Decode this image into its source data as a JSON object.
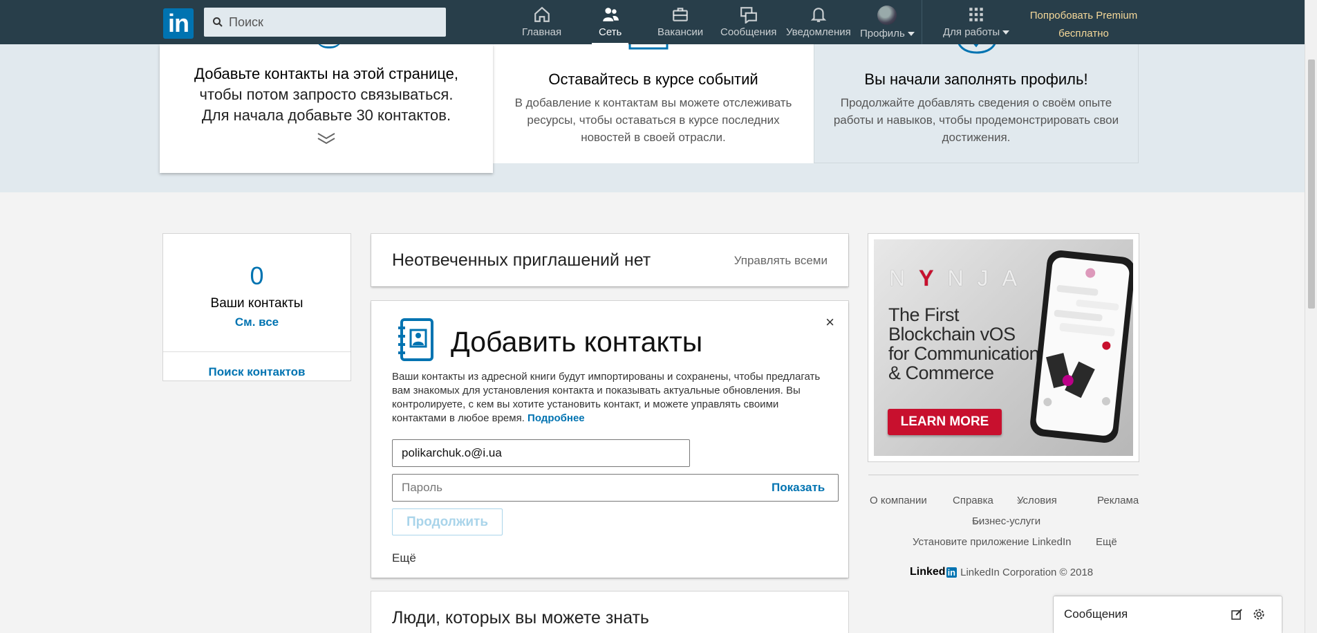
{
  "nav": {
    "search_placeholder": "Поиск",
    "items": [
      {
        "label": "Главная"
      },
      {
        "label": "Сеть"
      },
      {
        "label": "Вакансии"
      },
      {
        "label": "Сообщения"
      },
      {
        "label": "Уведомления"
      },
      {
        "label": "Профиль"
      },
      {
        "label": "Для работы"
      }
    ],
    "premium_line1": "Попробовать Premium",
    "premium_line2": "бесплатно",
    "logo": "in",
    "accent": "#0073b1",
    "bar_color": "#283e4a"
  },
  "banner": {
    "card1_title": "Добавьте контакты на этой странице,",
    "card1_line2": "чтобы потом запросто связываться.",
    "card1_line3": "Для начала добавьте 30 контактов.",
    "card2_title": "Оставайтесь в курсе событий",
    "card2_text": "В добавление к контактам вы можете отслеживать ресурсы, чтобы оставаться в курсе последних новостей в своей отрасли.",
    "card3_title": "Вы начали заполнять профиль!",
    "card3_text": "Продолжайте добавлять сведения о своём опыте работы и навыков, чтобы продемонстрировать свои достижения."
  },
  "left": {
    "count": "0",
    "label": "Ваши контакты",
    "see_all": "См. все",
    "find": "Поиск контактов"
  },
  "invites": {
    "title": "Неотвеченных приглашений нет",
    "manage": "Управлять всеми"
  },
  "add_contacts": {
    "title": "Добавить контакты",
    "desc": "Ваши контакты из адресной книги будут импортированы и сохранены, чтобы предлагать вам знакомых для установления контакта и показывать актуальные обновления. Вы контролируете, с кем вы хотите установить контакт, и можете управлять своими контактами в любое время.",
    "learn_more": "Подробнее",
    "email_value": "polikarchuk.o@i.ua",
    "password_placeholder": "Пароль",
    "show": "Показать",
    "continue": "Продолжить",
    "more": "Ещё",
    "close": "×"
  },
  "pymk": {
    "title": "Люди, которых вы можете знать"
  },
  "ad": {
    "brand_n": "N",
    "brand_y": "Y",
    "brand_rest": "NJA",
    "line1": "The First",
    "line2": "Blockchain vOS",
    "line3": "for Communication",
    "line4": "& Commerce",
    "button": "LEARN MORE"
  },
  "footer": {
    "about": "О компании",
    "help": "Справка",
    "terms": "Условия",
    "ads": "Реклама",
    "business": "Бизнес-услуги",
    "app": "Установите приложение LinkedIn",
    "more": "Ещё",
    "logo_word": "Linked",
    "logo_box": "in",
    "copyright": "LinkedIn Corporation © 2018"
  },
  "messaging": {
    "title": "Сообщения"
  }
}
